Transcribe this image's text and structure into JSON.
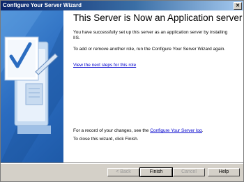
{
  "window": {
    "title": "Configure Your Server Wizard",
    "close_label": "✕"
  },
  "content": {
    "heading": "This Server is Now an Application server",
    "p1": "You have successfully set up this server as an application server by installing IIS.",
    "p2": "To add or remove another role, run the Configure Your Server Wizard again.",
    "link_next_steps": "View the next steps for this role",
    "record_prefix": "For a record of your changes, see the",
    "record_link": "Configure Your Server log",
    "record_suffix": ".",
    "close_text": "To close this wizard, click Finish."
  },
  "buttons": {
    "back": "< Back",
    "finish": "Finish",
    "cancel": "Cancel",
    "help": "Help"
  }
}
